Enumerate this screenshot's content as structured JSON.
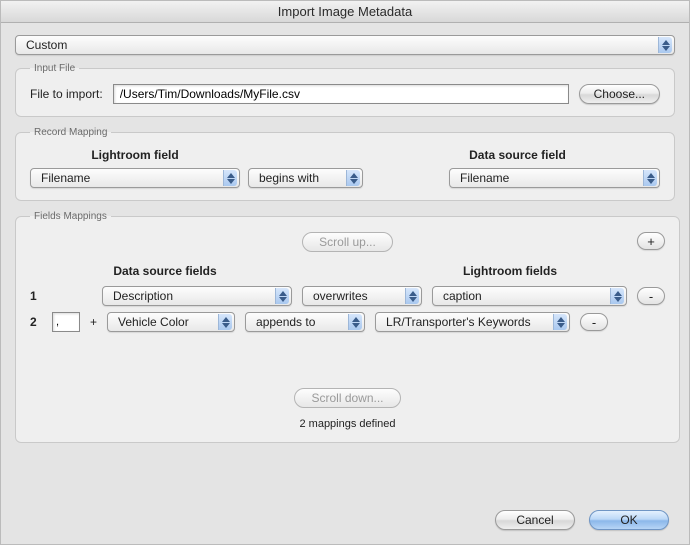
{
  "window_title": "Import Image Metadata",
  "preset": "Custom",
  "input_file": {
    "legend": "Input File",
    "label": "File to import:",
    "value": "/Users/Tim/Downloads/MyFile.csv",
    "choose_btn": "Choose..."
  },
  "record_mapping": {
    "legend": "Record Mapping",
    "col_lr": "Lightroom field",
    "col_ds": "Data source field",
    "lr_value": "Filename",
    "op_value": "begins with",
    "ds_value": "Filename"
  },
  "fields_mappings": {
    "legend": "Fields Mappings",
    "scroll_up": "Scroll up...",
    "scroll_down": "Scroll down...",
    "add_btn": "+",
    "col_ds": "Data source fields",
    "col_lr": "Lightroom fields",
    "rows": [
      {
        "num": "1",
        "prefix": "",
        "ds": "Description",
        "op": "overwrites",
        "lr": "caption"
      },
      {
        "num": "2",
        "prefix": ",",
        "plus": "+",
        "ds": "Vehicle Color",
        "op": "appends to",
        "lr": "LR/Transporter's Keywords"
      }
    ],
    "remove_btn": "-",
    "defined": "2 mappings defined"
  },
  "buttons": {
    "cancel": "Cancel",
    "ok": "OK"
  }
}
